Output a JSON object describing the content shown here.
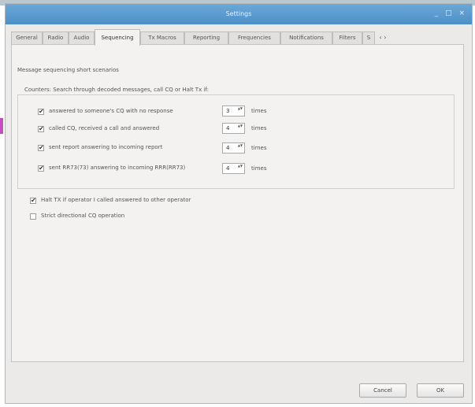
{
  "window": {
    "title": "Settings",
    "controls": "_ □ ×"
  },
  "tabs": [
    {
      "label": "General"
    },
    {
      "label": "Radio"
    },
    {
      "label": "Audio"
    },
    {
      "label": "Sequencing"
    },
    {
      "label": "Tx Macros"
    },
    {
      "label": "Reporting"
    },
    {
      "label": "Frequencies"
    },
    {
      "label": "Notifications"
    },
    {
      "label": "Filters"
    },
    {
      "label": "S"
    }
  ],
  "tab_scroll": "‹ ›",
  "active_tab": "Sequencing",
  "section_label": "Message sequencing short scenarios",
  "counters": {
    "label": "Counters: Search through decoded messages, call CQ or Halt Tx if:",
    "rows": [
      {
        "label": "answered to someone's CQ with no response",
        "value": "3",
        "unit": "times",
        "checked": true
      },
      {
        "label": "called CQ, received a call and answered",
        "value": "4",
        "unit": "times",
        "checked": true
      },
      {
        "label": "sent report answering to incoming report",
        "value": "4",
        "unit": "times",
        "checked": true
      },
      {
        "label": "sent RR73(73) answering to incoming RRR(RR73)",
        "value": "4",
        "unit": "times",
        "checked": true
      }
    ]
  },
  "options": [
    {
      "label": "Halt TX if operator I called answered to other operator",
      "checked": true
    },
    {
      "label": "Strict directional CQ operation",
      "checked": false
    }
  ],
  "check_glyph": "✔",
  "spin_glyph": "▲▼",
  "buttons": {
    "cancel": "Cancel",
    "ok": "OK"
  }
}
